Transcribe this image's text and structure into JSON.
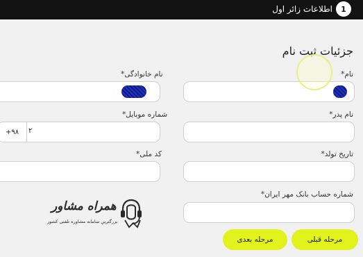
{
  "header": {
    "step_number": "1",
    "step_title": "اطلاعات زائر اول"
  },
  "form": {
    "title": "جزئیات ثبت نام",
    "fields": {
      "first_name": {
        "label": "نام",
        "required": "*",
        "value": ""
      },
      "last_name": {
        "label": "نام خانوادگی",
        "required": "*",
        "value": ""
      },
      "father_name": {
        "label": "نام پدر",
        "required": "*",
        "value": ""
      },
      "mobile": {
        "label": "شماره موبایل",
        "required": "*",
        "country_code": "+۹۸",
        "value": "۲"
      },
      "birth_date": {
        "label": "تاریخ تولد",
        "required": "*",
        "value": ""
      },
      "national_code": {
        "label": "کد ملی",
        "required": "*",
        "value": ""
      },
      "bank_account": {
        "label": "شماره حساب بانک مهر ایران",
        "required": "*",
        "value": ""
      }
    }
  },
  "buttons": {
    "previous": "مرحله قبلی",
    "next": "مرحله بعدی"
  },
  "watermark": {
    "title": "همراه مشاور",
    "subtitle": "بزرگترین سامانه مشاوره تلفنی کشور"
  },
  "colors": {
    "topbar": "#121212",
    "button_accent": "#e2f21c",
    "redaction": "#1a27a8"
  }
}
